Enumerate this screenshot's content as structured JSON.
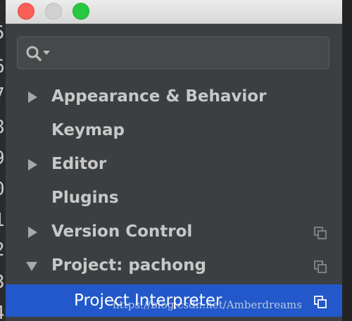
{
  "gutter": {
    "line_numbers": [
      "5",
      "6",
      "7",
      "8",
      "9",
      "0",
      "1",
      "2",
      "3",
      "4"
    ]
  },
  "window": {
    "title_buttons": [
      "close",
      "minimize",
      "zoom"
    ]
  },
  "search": {
    "value": "",
    "placeholder": "",
    "icon": "search-with-dropdown-icon"
  },
  "tree": {
    "items": [
      {
        "label": "Appearance & Behavior",
        "arrow": "collapsed",
        "project_icon": false,
        "selected": false
      },
      {
        "label": "Keymap",
        "arrow": "none",
        "project_icon": false,
        "selected": false
      },
      {
        "label": "Editor",
        "arrow": "collapsed",
        "project_icon": false,
        "selected": false
      },
      {
        "label": "Plugins",
        "arrow": "none",
        "project_icon": false,
        "selected": false
      },
      {
        "label": "Version Control",
        "arrow": "collapsed",
        "project_icon": true,
        "selected": false
      },
      {
        "label": "Project: pachong",
        "arrow": "expanded",
        "project_icon": true,
        "selected": false
      },
      {
        "label": "Project Interpreter",
        "arrow": "none",
        "project_icon": true,
        "selected": true
      }
    ]
  },
  "watermark": {
    "text": "https://blog.csdn.net/Amberdreams"
  },
  "colors": {
    "panel_bg": "#3c3f41",
    "selection": "#2258c9",
    "text": "#c8c8c8",
    "selected_text": "#ffffff",
    "close": "#fc5f57",
    "minimize": "#d1d1d1",
    "zoom": "#28c840"
  }
}
